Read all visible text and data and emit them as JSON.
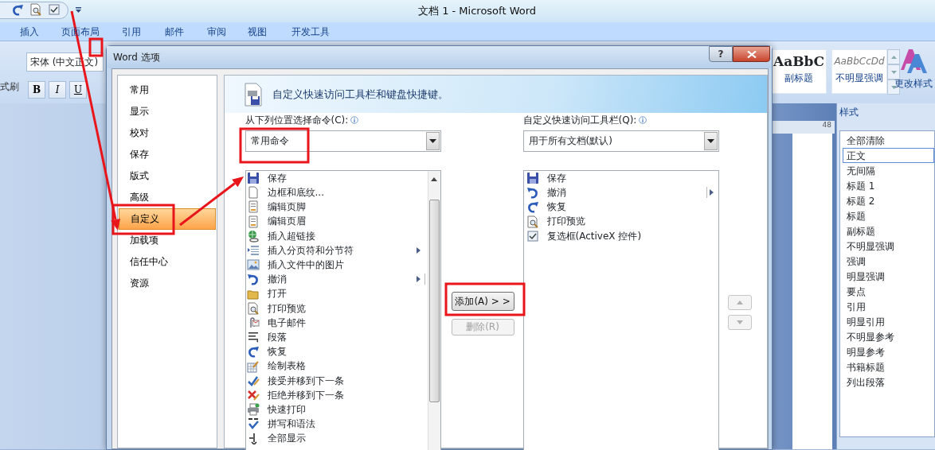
{
  "window": {
    "title": "文档 1 - Microsoft Word"
  },
  "ribbon_tabs": [
    "插入",
    "页面布局",
    "引用",
    "邮件",
    "审阅",
    "视图",
    "开发工具"
  ],
  "ribbon": {
    "clipboard_label": "式刷",
    "font_name": "宋体 (中文正文)",
    "format_buttons": [
      {
        "label": "B",
        "kind": "bold"
      },
      {
        "label": "I",
        "kind": "italic"
      },
      {
        "label": "U",
        "kind": "underline"
      }
    ],
    "style_gallery": [
      {
        "sample": "AaBbC",
        "name": "副标题",
        "kind": "bold"
      },
      {
        "sample": "AaBbCcDd",
        "name": "不明显强调",
        "kind": "italic"
      }
    ],
    "change_styles": "更改样式"
  },
  "ruler": {
    "number": "48"
  },
  "styles_pane": {
    "title": "样式",
    "items": [
      {
        "label": "全部清除",
        "selected": false
      },
      {
        "label": "正文",
        "selected": true
      },
      {
        "label": "无间隔",
        "selected": false
      },
      {
        "label": "标题 1",
        "selected": false
      },
      {
        "label": "标题 2",
        "selected": false
      },
      {
        "label": "标题",
        "selected": false
      },
      {
        "label": "副标题",
        "selected": false
      },
      {
        "label": "不明显强调",
        "selected": false
      },
      {
        "label": "强调",
        "selected": false
      },
      {
        "label": "明显强调",
        "selected": false
      },
      {
        "label": "要点",
        "selected": false
      },
      {
        "label": "引用",
        "selected": false
      },
      {
        "label": "明显引用",
        "selected": false
      },
      {
        "label": "不明显参考",
        "selected": false
      },
      {
        "label": "明显参考",
        "selected": false
      },
      {
        "label": "书籍标题",
        "selected": false
      },
      {
        "label": "列出段落",
        "selected": false
      }
    ]
  },
  "dialog": {
    "title": "Word 选项",
    "help": "?",
    "nav": [
      {
        "label": "常用",
        "selected": false
      },
      {
        "label": "显示",
        "selected": false
      },
      {
        "label": "校对",
        "selected": false
      },
      {
        "label": "保存",
        "selected": false
      },
      {
        "label": "版式",
        "selected": false
      },
      {
        "label": "高级",
        "selected": false
      },
      {
        "label": "自定义",
        "selected": true
      },
      {
        "label": "加载项",
        "selected": false
      },
      {
        "label": "信任中心",
        "selected": false
      },
      {
        "label": "资源",
        "selected": false
      }
    ],
    "header": "自定义快速访问工具栏和键盘快捷键。",
    "commands_label": "从下列位置选择命令(C):",
    "commands_source": "常用命令",
    "commands": [
      {
        "label": "保存",
        "submenu": false
      },
      {
        "label": "边框和底纹...",
        "submenu": false
      },
      {
        "label": "编辑页脚",
        "submenu": false
      },
      {
        "label": "编辑页眉",
        "submenu": false
      },
      {
        "label": "插入超链接",
        "submenu": false
      },
      {
        "label": "插入分页符和分节符",
        "submenu": true
      },
      {
        "label": "插入文件中的图片",
        "submenu": false
      },
      {
        "label": "撤消",
        "submenu": true
      },
      {
        "label": "打开",
        "submenu": false
      },
      {
        "label": "打印预览",
        "submenu": false
      },
      {
        "label": "电子邮件",
        "submenu": false
      },
      {
        "label": "段落",
        "submenu": false
      },
      {
        "label": "恢复",
        "submenu": false
      },
      {
        "label": "绘制表格",
        "submenu": false
      },
      {
        "label": "接受并移到下一条",
        "submenu": false
      },
      {
        "label": "拒绝并移到下一条",
        "submenu": false
      },
      {
        "label": "快速打印",
        "submenu": false
      },
      {
        "label": "拼写和语法",
        "submenu": false
      },
      {
        "label": "全部显示",
        "submenu": false
      }
    ],
    "toolbar_label": "自定义快速访问工具栏(Q):",
    "toolbar_scope": "用于所有文档(默认)",
    "toolbar_items": [
      {
        "label": "保存",
        "submenu": false
      },
      {
        "label": "撤消",
        "submenu": true
      },
      {
        "label": "恢复",
        "submenu": false
      },
      {
        "label": "打印预览",
        "submenu": false
      },
      {
        "label": "复选框(ActiveX 控件)",
        "submenu": false
      }
    ],
    "add_button": {
      "label": "添加(A) > >",
      "disabled": false
    },
    "remove_button": {
      "label": "删除(R)",
      "disabled": true
    },
    "move_up": {
      "disabled": true
    },
    "move_down": {
      "disabled": true
    }
  }
}
